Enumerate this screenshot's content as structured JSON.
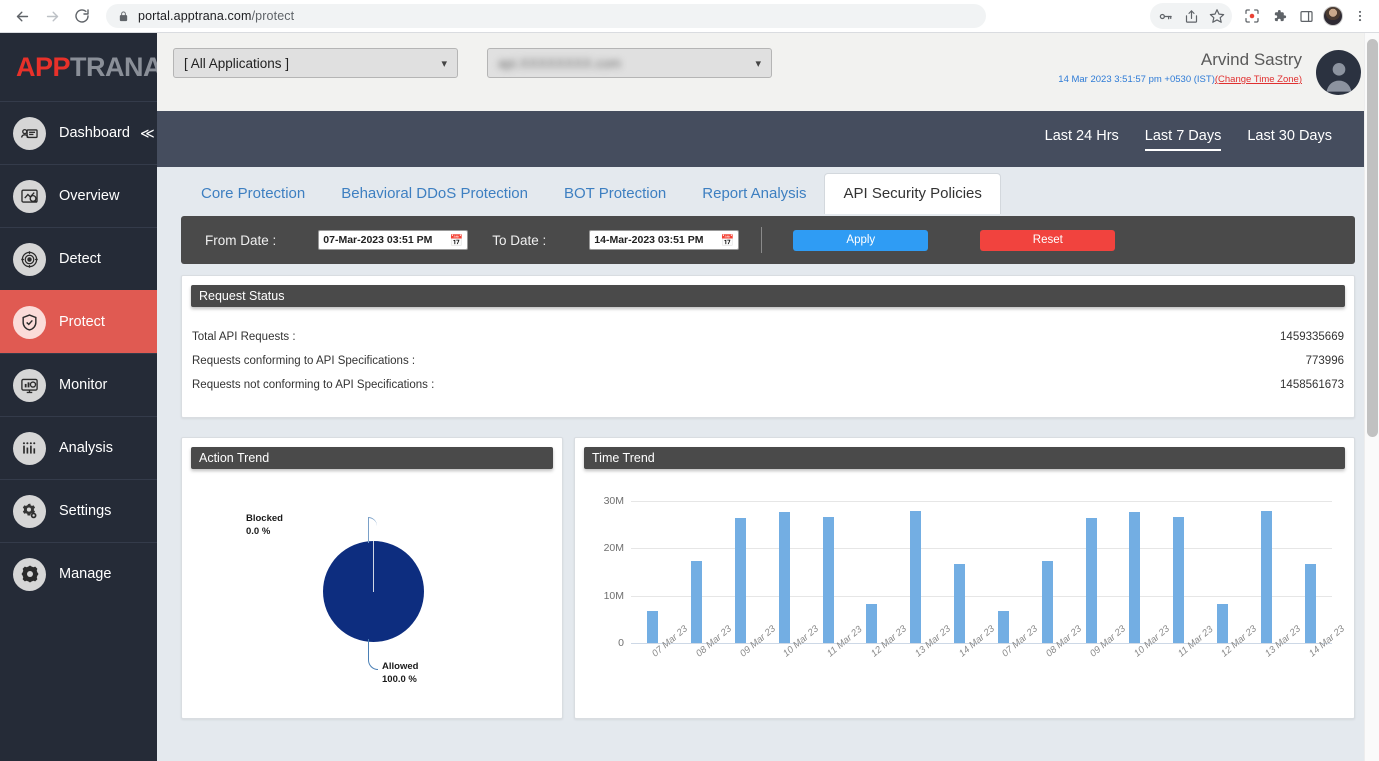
{
  "browser": {
    "url_host": "portal.apptrana.com",
    "url_path": "/protect",
    "back_icon": "back-arrow-icon",
    "forward_icon": "forward-arrow-icon",
    "reload_icon": "reload-icon",
    "lock_icon": "lock-icon",
    "toolbar_icons": [
      "password-key-icon",
      "share-icon",
      "bookmark-star-icon",
      "screenshot-capture-icon",
      "extensions-puzzle-icon",
      "side-panel-icon",
      "profile-avatar-icon",
      "kebab-menu-icon"
    ]
  },
  "sidebar": {
    "logo_first": "APP",
    "logo_second": "TRANA",
    "items": [
      {
        "label": "Dashboard",
        "icon": "dashboard-icon",
        "active": false,
        "collapse": "≪"
      },
      {
        "label": "Overview",
        "icon": "overview-icon",
        "active": false
      },
      {
        "label": "Detect",
        "icon": "detect-target-icon",
        "active": false
      },
      {
        "label": "Protect",
        "icon": "protect-shield-icon",
        "active": true
      },
      {
        "label": "Monitor",
        "icon": "monitor-screen-icon",
        "active": false
      },
      {
        "label": "Analysis",
        "icon": "analysis-bars-icon",
        "active": false
      },
      {
        "label": "Settings",
        "icon": "settings-gears-icon",
        "active": false
      },
      {
        "label": "Manage",
        "icon": "manage-gear-icon",
        "active": false
      }
    ]
  },
  "header": {
    "app_selector_value": "[ All Applications ]",
    "domain_selector_value": "api.XXXXXXXX.com",
    "domain_selector_blurred": true,
    "user_name": "Arvind Sastry",
    "timestamp": "14 Mar 2023 3:51:57 pm +0530 (IST)",
    "change_timezone": "(Change Time Zone)",
    "avatar_icon": "user-avatar-icon"
  },
  "period_bar": {
    "options": [
      {
        "label": "Last 24 Hrs",
        "active": false
      },
      {
        "label": "Last 7 Days",
        "active": true
      },
      {
        "label": "Last 30 Days",
        "active": false
      }
    ]
  },
  "tabs": [
    {
      "label": "Core Protection",
      "active": false
    },
    {
      "label": "Behavioral DDoS Protection",
      "active": false
    },
    {
      "label": "BOT Protection",
      "active": false
    },
    {
      "label": "Report Analysis",
      "active": false
    },
    {
      "label": "API Security Policies",
      "active": true
    }
  ],
  "filter_bar": {
    "from_label": "From Date :",
    "from_value": "07-Mar-2023 03:51 PM",
    "to_label": "To Date :",
    "to_value": "14-Mar-2023 03:51 PM",
    "calendar_icon": "calendar-icon",
    "apply_label": "Apply",
    "reset_label": "Reset",
    "apply_color": "#2f9cf4",
    "reset_color": "#f1433e"
  },
  "request_status": {
    "title": "Request Status",
    "rows": [
      {
        "label": "Total API Requests :",
        "value": "1459335669"
      },
      {
        "label": "Requests conforming to API Specifications :",
        "value": "773996"
      },
      {
        "label": "Requests not conforming to API Specifications :",
        "value": "1458561673"
      }
    ]
  },
  "chart_data": [
    {
      "type": "pie",
      "title": "Action Trend",
      "labels": [
        "Blocked",
        "Allowed"
      ],
      "values": [
        0.0,
        100.0
      ],
      "value_labels": [
        "0.0 %",
        "100.0 %"
      ],
      "colors": [
        "#0d2d7f",
        "#0d2d7f"
      ],
      "legend": "annotations-with-leader-lines"
    },
    {
      "type": "bar",
      "title": "Time Trend",
      "categories": [
        "07 Mar 23",
        "08 Mar 23",
        "09 Mar 23",
        "10 Mar 23",
        "11 Mar 23",
        "12 Mar 23",
        "13 Mar 23",
        "14 Mar 23",
        "07 Mar 23",
        "08 Mar 23",
        "09 Mar 23",
        "10 Mar 23",
        "11 Mar 23",
        "12 Mar 23",
        "13 Mar 23",
        "14 Mar 23"
      ],
      "values": [
        6800000,
        17200000,
        26300000,
        27500000,
        26500000,
        8300000,
        27800000,
        16700000,
        6800000,
        17200000,
        26300000,
        27500000,
        26500000,
        8300000,
        27800000,
        16700000
      ],
      "ytick_labels": [
        "30M",
        "20M",
        "10M",
        "0"
      ],
      "ytick_values": [
        30000000,
        20000000,
        10000000,
        0
      ],
      "ylim": [
        0,
        32000000
      ],
      "xlabel": "",
      "ylabel": "",
      "grid": true,
      "bar_color": "#73aee3",
      "legend": "none"
    }
  ]
}
